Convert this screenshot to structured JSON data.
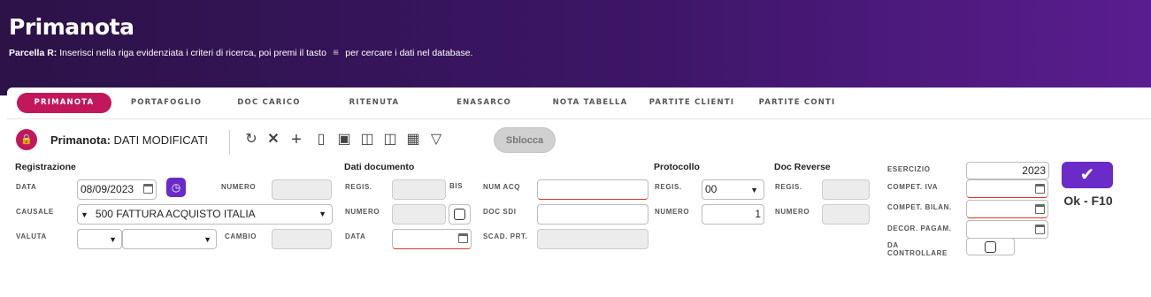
{
  "header": {
    "title": "Primanota",
    "hint_bold": "Parcella R:",
    "hint_before": "Inserisci nella riga evidenziata i criteri di ricerca, poi premi il tasto",
    "hint_icon": "filter-icon",
    "hint_after": "per cercare i dati nel database."
  },
  "tabs": [
    {
      "label": "PRIMANOTA",
      "active": true
    },
    {
      "label": "PORTAFOGLIO",
      "active": false
    },
    {
      "label": "DOC CARICO",
      "active": false
    },
    {
      "label": "RITENUTA",
      "active": false
    },
    {
      "label": "ENASARCO",
      "active": false
    },
    {
      "label": "NOTA TABELLA",
      "active": false
    },
    {
      "label": "PARTITE CLIENTI",
      "active": false
    },
    {
      "label": "PARTITE CONTI",
      "active": false
    }
  ],
  "toolbar": {
    "title_bold": "Primanota:",
    "title_status": "DATI MODIFICATI",
    "icons": [
      "undo-icon",
      "delete-icon",
      "add-icon",
      "copy-icon",
      "save-icon",
      "print-icon",
      "columns-icon",
      "layout-icon",
      "filter-icon"
    ],
    "sblocca_label": "Sblocca"
  },
  "registrazione": {
    "header": "Registrazione",
    "data_label": "DATA",
    "data_value": "08/09/2023",
    "numero_label": "NUMERO",
    "numero_value": "",
    "causale_label": "CAUSALE",
    "causale_code": "500",
    "causale_value": "FATTURA ACQUISTO ITALIA",
    "valuta_label": "VALUTA",
    "valuta_value": "",
    "valuta_desc": "",
    "cambio_label": "CAMBIO",
    "cambio_value": ""
  },
  "dati_documento": {
    "header": "Dati documento",
    "regis_label": "REGIS.",
    "regis_value": "",
    "bis_label": "BIS",
    "numero_label": "NUMERO",
    "numero_value": "",
    "data_label": "DATA",
    "data_value": "",
    "num_acq_label": "NUM ACQ",
    "num_acq_value": "",
    "doc_sdi_label": "DOC SDI",
    "doc_sdi_value": "",
    "scad_prt_label": "SCAD. PRT.",
    "scad_prt_value": ""
  },
  "protocollo": {
    "header": "Protocollo",
    "regis_label": "REGIS.",
    "regis_value": "00",
    "numero_label": "NUMERO",
    "numero_value": "1"
  },
  "doc_reverse": {
    "header": "Doc Reverse",
    "regis_label": "REGIS.",
    "regis_value": "",
    "numero_label": "NUMERO",
    "numero_value": ""
  },
  "esercizio": {
    "esercizio_label": "ESERCIZIO",
    "esercizio_value": "2023",
    "compet_iva_label": "COMPET. IVA",
    "compet_bilan_label": "COMPET. BILAN.",
    "decor_pagam_label": "DECOR. PAGAM.",
    "da_controllare_label": "DA CONTROLLARE"
  },
  "ok_button": {
    "label": "Ok - F10",
    "icon": "check-icon"
  }
}
